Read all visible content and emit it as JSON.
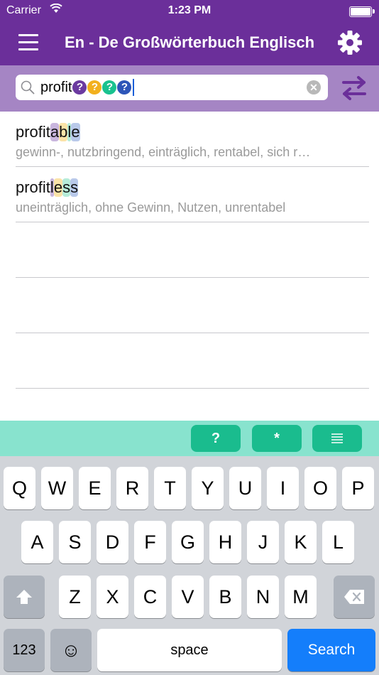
{
  "status": {
    "carrier": "Carrier",
    "time": "1:23 PM"
  },
  "nav": {
    "title": "En - De Großwörterbuch Englisch"
  },
  "search": {
    "text": "profit",
    "wildcards": [
      "?",
      "?",
      "?",
      "?"
    ],
    "wildcard_colors": [
      "#6b3aa0",
      "#f2b01e",
      "#19c28f",
      "#2d55b8"
    ],
    "clear_label": "✕"
  },
  "results": [
    {
      "prefix": "profit",
      "parts": [
        "a",
        "b",
        "l",
        "e"
      ],
      "translation": "gewinn-, nutzbringend, einträglich, rentabel, sich r…"
    },
    {
      "prefix": "profit",
      "parts": [
        "l",
        "e",
        "s",
        "s"
      ],
      "translation": "uneinträglich, ohne Gewinn, Nutzen, unrentabel"
    }
  ],
  "highlight_colors": [
    "#c9b6de",
    "#fbe3a8",
    "#b6ecd9",
    "#b9c9ea"
  ],
  "wildcard_bar": {
    "question": "?",
    "star": "*",
    "list_icon": "list-icon"
  },
  "keyboard": {
    "row1": [
      "Q",
      "W",
      "E",
      "R",
      "T",
      "Y",
      "U",
      "I",
      "O",
      "P"
    ],
    "row2": [
      "A",
      "S",
      "D",
      "F",
      "G",
      "H",
      "J",
      "K",
      "L"
    ],
    "row3": [
      "Z",
      "X",
      "C",
      "V",
      "B",
      "N",
      "M"
    ],
    "numbers": "123",
    "space": "space",
    "search": "Search",
    "emoji": "☺"
  },
  "colors": {
    "nav": "#6b2f9a",
    "search_band": "#a585c4",
    "wildcard_bar": "#88e3ce",
    "wildcard_button": "#1abc8e",
    "search_key": "#147efb"
  }
}
